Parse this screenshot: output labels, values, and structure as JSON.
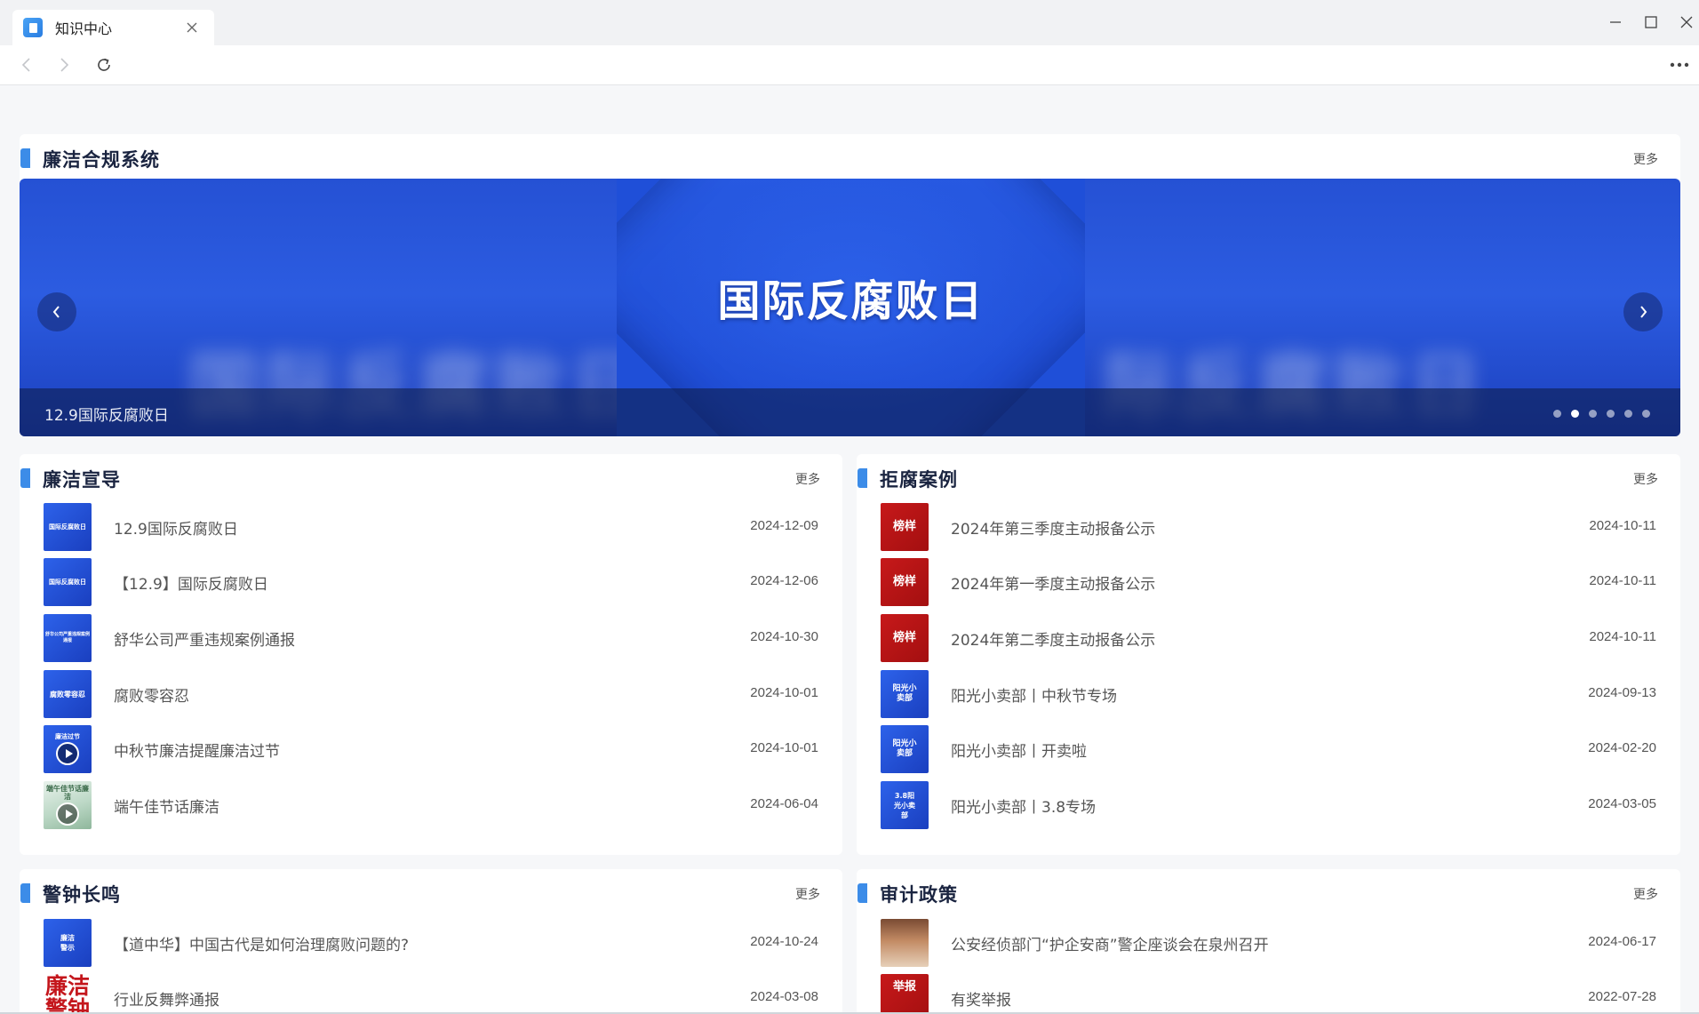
{
  "browser": {
    "tab_title": "知识中心",
    "colors": {
      "accent": "#3c8ce8",
      "banner_blue": "#2554d6",
      "title_dark": "#1a2440"
    }
  },
  "banner_section": {
    "title": "廉洁合规系统",
    "more": "更多",
    "banner": {
      "headline": "国际反腐败日",
      "blurred_text_left": "国际反腐败日",
      "blurred_text_right": "际反腐败日",
      "caption": "12.9国际反腐败日",
      "slide_count": 6,
      "active_slide": 2
    }
  },
  "sections": {
    "promo": {
      "title": "廉洁宣导",
      "more": "更多",
      "items": [
        {
          "title": "12.9国际反腐败日",
          "date": "2024-12-09",
          "thumb": "国际反腐败日"
        },
        {
          "title": "【12.9】国际反腐败日",
          "date": "2024-12-06",
          "thumb": "国际反腐败日"
        },
        {
          "title": "舒华公司严重违规案例通报",
          "date": "2024-10-30",
          "thumb": "舒华公司严重违规案例通报"
        },
        {
          "title": "腐败零容忍",
          "date": "2024-10-01",
          "thumb": "腐败零容忍"
        },
        {
          "title": "中秋节廉洁提醒廉洁过节",
          "date": "2024-10-01",
          "thumb": "廉洁过节"
        },
        {
          "title": "端午佳节话廉洁",
          "date": "2024-06-04",
          "thumb": "端午佳节话廉洁"
        }
      ]
    },
    "cases": {
      "title": "拒腐案例",
      "more": "更多",
      "items": [
        {
          "title": "2024年第三季度主动报备公示",
          "date": "2024-10-11",
          "thumb": "榜样"
        },
        {
          "title": "2024年第一季度主动报备公示",
          "date": "2024-10-11",
          "thumb": "榜样"
        },
        {
          "title": "2024年第二季度主动报备公示",
          "date": "2024-10-11",
          "thumb": "榜样"
        },
        {
          "title": "阳光小卖部丨中秋节专场",
          "date": "2024-09-13",
          "thumb": "阳光小卖部"
        },
        {
          "title": "阳光小卖部丨开卖啦",
          "date": "2024-02-20",
          "thumb": "阳光小卖部"
        },
        {
          "title": "阳光小卖部丨3.8专场",
          "date": "2024-03-05",
          "thumb": "3.8阳光小卖部"
        }
      ]
    },
    "alarm": {
      "title": "警钟长鸣",
      "more": "更多",
      "items": [
        {
          "title": "【道中华】中国古代是如何治理腐败问题的?",
          "date": "2024-10-24",
          "thumb": "廉洁警示"
        },
        {
          "title": "行业反舞弊通报",
          "date": "2024-03-08",
          "thumb": "廉洁警钟"
        }
      ]
    },
    "audit": {
      "title": "审计政策",
      "more": "更多",
      "items": [
        {
          "title": "公安经侦部门“护企安商”警企座谈会在泉州召开",
          "date": "2024-06-17",
          "thumb": ""
        },
        {
          "title": "有奖举报",
          "date": "2022-07-28",
          "thumb": "举报"
        }
      ]
    }
  }
}
